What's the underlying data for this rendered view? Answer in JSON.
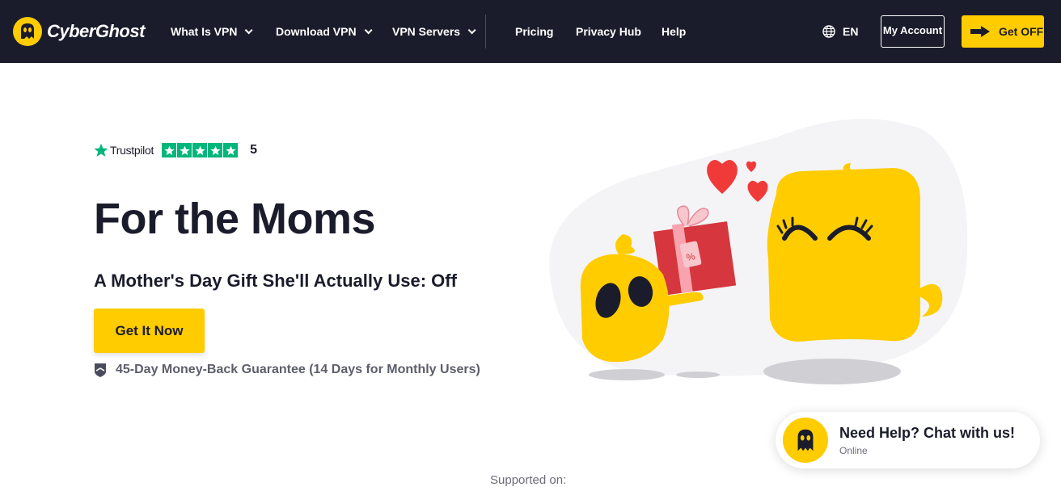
{
  "header": {
    "logo_text": "CyberGhost",
    "nav": [
      {
        "label": "What Is VPN",
        "dropdown": true
      },
      {
        "label": "Download VPN",
        "dropdown": true
      },
      {
        "label": "VPN Servers",
        "dropdown": true
      },
      {
        "label": "Pricing",
        "dropdown": false
      },
      {
        "label": "Privacy Hub",
        "dropdown": false
      },
      {
        "label": "Help",
        "dropdown": false
      }
    ],
    "language": "EN",
    "my_account": "My Account",
    "get_off": "Get OFF"
  },
  "hero": {
    "trustpilot": {
      "name": "Trustpilot",
      "score": "5",
      "stars": 5
    },
    "title": "For the Moms",
    "subtitle": "A Mother's Day Gift She'll Actually Use: Off",
    "cta": "Get It Now",
    "guarantee": "45-Day Money-Back Guarantee (14 Days for Monthly Users)"
  },
  "chat": {
    "title": "Need Help? Chat with us!",
    "status": "Online"
  },
  "footer": {
    "supported_on": "Supported on:"
  },
  "colors": {
    "navy": "#1b1c2b",
    "brand_yellow": "#ffcc00",
    "trustpilot_green": "#00b67a",
    "heart_red": "#f03a3a"
  }
}
